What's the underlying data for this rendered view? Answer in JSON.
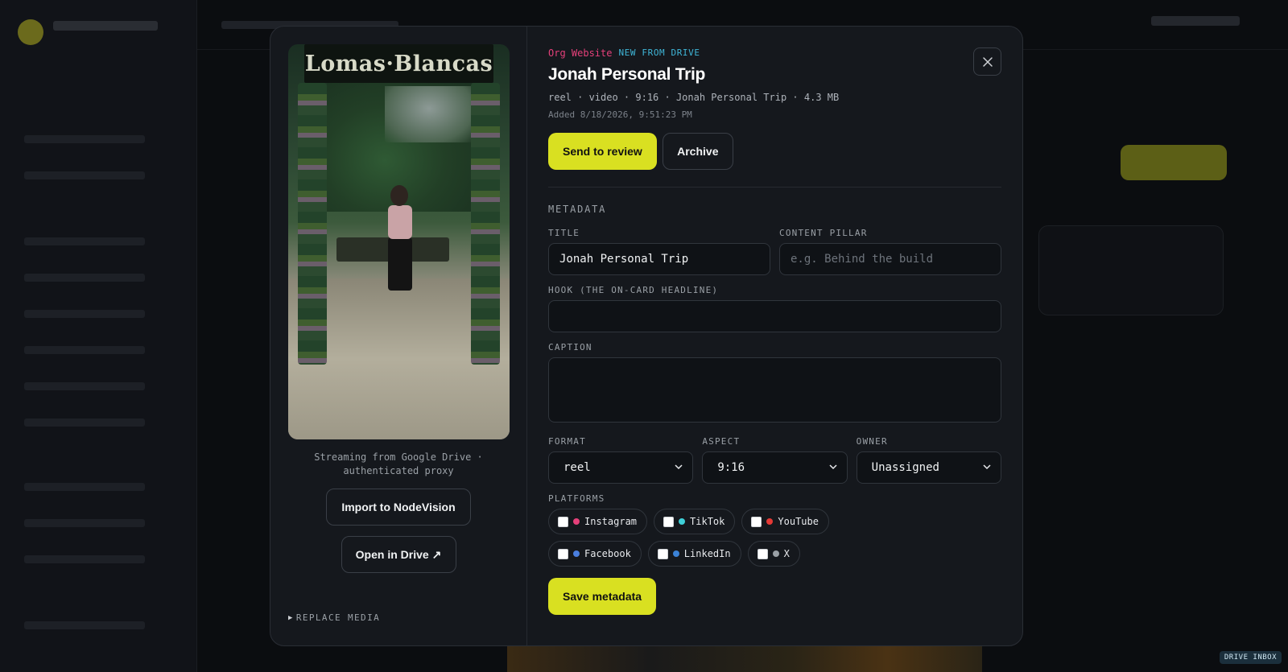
{
  "modal": {
    "left": {
      "media_alt": "Lomas Blancas",
      "sign_text": "Lomas·Blancas",
      "stream_note_line1": "Streaming from Google Drive ·",
      "stream_note_line2": "authenticated proxy",
      "import_label": "Import to NodeVision",
      "open_drive_label": "Open in Drive ↗",
      "replace_label": "REPLACE MEDIA"
    },
    "right": {
      "tag_org": "Org Website",
      "tag_new": "NEW FROM DRIVE",
      "title": "Jonah Personal Trip",
      "meta_line": "reel · video · 9:16 · Jonah Personal Trip · 4.3 MB",
      "added_line": "Added 8/18/2026, 9:51:23 PM",
      "send_review_label": "Send to review",
      "archive_label": "Archive",
      "close_icon": "close-icon",
      "metadata_heading": "METADATA",
      "title_label": "TITLE",
      "title_value": "Jonah Personal Trip",
      "pillar_label": "CONTENT PILLAR",
      "pillar_placeholder": "e.g. Behind the build",
      "hook_label": "HOOK (THE ON-CARD HEADLINE)",
      "hook_value": "",
      "caption_label": "CAPTION",
      "caption_value": "",
      "format_label": "FORMAT",
      "format_value": "reel",
      "aspect_label": "ASPECT",
      "aspect_value": "9:16",
      "owner_label": "OWNER",
      "owner_value": "Unassigned",
      "platforms_label": "PLATFORMS",
      "platforms": [
        {
          "name": "Instagram",
          "color": "#e5407a",
          "checked": false
        },
        {
          "name": "TikTok",
          "color": "#3fd0d8",
          "checked": false
        },
        {
          "name": "YouTube",
          "color": "#e53935",
          "checked": false
        },
        {
          "name": "Facebook",
          "color": "#4a7fe0",
          "checked": false
        },
        {
          "name": "LinkedIn",
          "color": "#3b82d6",
          "checked": false
        },
        {
          "name": "X",
          "color": "#9aa0a6",
          "checked": false
        }
      ],
      "save_label": "Save metadata"
    }
  },
  "drive_badge": "DRIVE INBOX",
  "colors": {
    "accent": "#d9e021",
    "modal_bg": "#15181d",
    "tag_org": "#e5407a",
    "tag_new": "#3fb6d8"
  }
}
